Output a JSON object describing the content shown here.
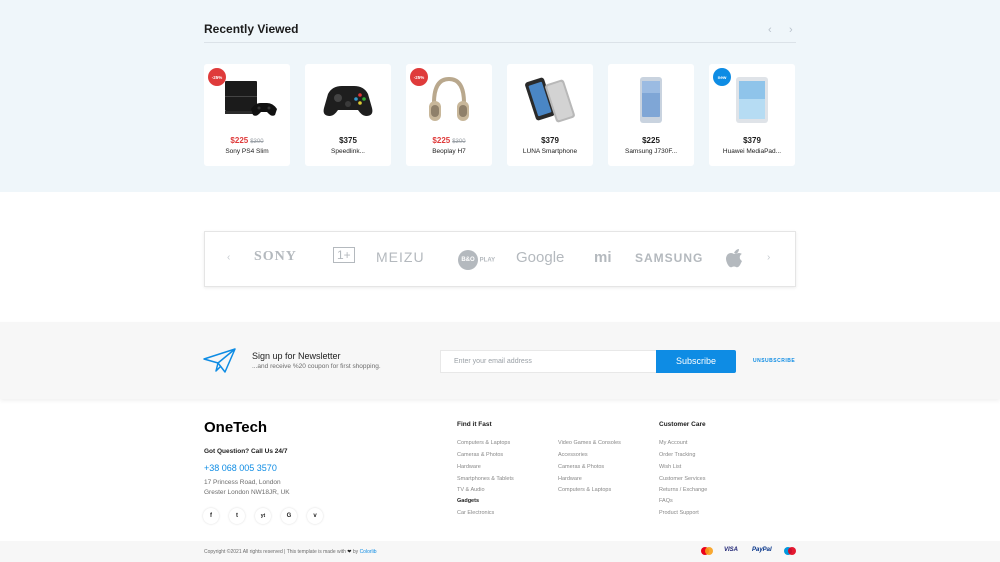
{
  "recently_viewed": {
    "title": "Recently Viewed",
    "prev_label": "‹",
    "next_label": "›",
    "products": [
      {
        "name": "Sony PS4 Slim",
        "price": "$225",
        "old_price": "$300",
        "badge": "-25%",
        "badge_type": "discount",
        "image": "console-icon"
      },
      {
        "name": "Speedlink...",
        "price": "$375",
        "old_price": "",
        "badge": "",
        "badge_type": "",
        "image": "gamepad-icon"
      },
      {
        "name": "Beoplay H7",
        "price": "$225",
        "old_price": "$300",
        "badge": "-25%",
        "badge_type": "discount",
        "image": "headphones-icon"
      },
      {
        "name": "LUNA Smartphone",
        "price": "$379",
        "old_price": "",
        "badge": "",
        "badge_type": "",
        "image": "smartphone-icon"
      },
      {
        "name": "Samsung J730F...",
        "price": "$225",
        "old_price": "",
        "badge": "",
        "badge_type": "",
        "image": "phone-icon"
      },
      {
        "name": "Huawei MediaPad...",
        "price": "$379",
        "old_price": "",
        "badge": "new",
        "badge_type": "new",
        "image": "tablet-icon"
      }
    ]
  },
  "brands": {
    "prev_label": "‹",
    "next_label": "›",
    "items": [
      "SONY",
      "1+",
      "MEIZU",
      "B&O PLAY",
      "Google",
      "mi",
      "SAMSUNG",
      "apple-icon"
    ]
  },
  "newsletter": {
    "title": "Sign up for Newsletter",
    "subtitle": "...and receive %20 coupon for first shopping.",
    "placeholder": "Enter your email address",
    "button": "Subscribe",
    "unsubscribe": "UNSUBSCRIBE"
  },
  "footer": {
    "logo": "OneTech",
    "question": "Got Question? Call Us 24/7",
    "phone": "+38 068 005 3570",
    "address_line1": "17 Princess Road, London",
    "address_line2": "Grester London NW18JR, UK",
    "social": [
      "f",
      "t",
      "yt",
      "G",
      "v"
    ],
    "find_title": "Find it Fast",
    "find_col1": [
      "Computers & Laptops",
      "Cameras & Photos",
      "Hardware",
      "Smartphones & Tablets",
      "TV & Audio",
      "Gadgets",
      "Car Electronics"
    ],
    "find_col2": [
      "Video Games & Consoles",
      "Accessories",
      "Cameras & Photos",
      "Hardware",
      "Computers & Laptops"
    ],
    "care_title": "Customer Care",
    "care_links": [
      "My Account",
      "Order Tracking",
      "Wish List",
      "Customer Services",
      "Returns / Exchange",
      "FAQs",
      "Product Support"
    ]
  },
  "copyright": {
    "text": "Copyright ©2021 All rights reserved | This template is made with",
    "by": "by",
    "link": "Colorlib"
  },
  "payments": [
    "mastercard-icon",
    "VISA",
    "PayPal",
    "maestro-icon"
  ],
  "colors": {
    "accent": "#0e8ce4",
    "sale": "#df3b3b",
    "section_bg": "#eff6fa"
  }
}
